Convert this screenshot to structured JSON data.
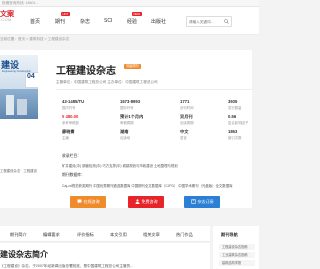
{
  "topbar": {
    "text": "投稿咨询热线: 18601..."
  },
  "logo": {
    "line1": "文案",
    "line2": ".COM"
  },
  "nav": [
    {
      "label": "首页"
    },
    {
      "label": "期刊",
      "badge": "HOT"
    },
    {
      "label": "杂志"
    },
    {
      "label": "SCI"
    },
    {
      "label": "经验",
      "badge": "NEW"
    },
    {
      "label": "出版社"
    }
  ],
  "search": {
    "placeholder": "请输入关键词..."
  },
  "breadcrumb": "当前位置：首页 > 建筑科技 > 工程建设杂志",
  "journal": {
    "cover": {
      "title": "建设",
      "subtitle": "Engineering Construction",
      "issue": "04"
    },
    "cover_caption": "工程建设杂志 · 工程建设",
    "title": "工程建设杂志",
    "tag": "省级期刊",
    "info": "主管单位：中国建筑工程总公司   主办单位：中国建筑工程总公司"
  },
  "fields": [
    {
      "value": "43-1485/TU",
      "label": "国内刊号"
    },
    {
      "value": "1673-8993",
      "label": "国际刊号"
    },
    {
      "value": "1771",
      "label": "创刊时间"
    },
    {
      "value": "3935",
      "label": "发行数量"
    },
    {
      "value": "¥ 480.00",
      "label": "参考审稿费"
    },
    {
      "value": "预计1个月内",
      "label": "审稿周期"
    },
    {
      "value": "双月刊",
      "label": "出版周期"
    },
    {
      "value": "0.56",
      "label": "复合影响因子"
    },
    {
      "value": "廖晓青",
      "label": "主编"
    },
    {
      "value": "湖南",
      "label": "出版地"
    },
    {
      "value": "中文",
      "label": "语言"
    },
    {
      "value": "1863",
      "label": "被引次数"
    }
  ],
  "columns_heading": "收录栏目：",
  "columns": "矿井建设(中)   钢管检测(中)   巧方支撑(中)   城镇规划与市政建设   土地整理与规划",
  "database_heading": "期刊数据库：",
  "databases": "Caj-cd规范获奖期刊   中国优秀期刊遴选数据库   中国期刊全文数据库（CJFD）   中国学术期刊（光盘版）全文数据库",
  "buttons": [
    {
      "label": "在线咨询",
      "color": "#f08b2c"
    },
    {
      "label": "免费咨询",
      "color": "#e8242b"
    },
    {
      "label": "杂志订阅",
      "color": "#2b7fd4"
    }
  ],
  "tabs": [
    "期刊简介",
    "编辑要求",
    "评价指标",
    "本文引用",
    "相关文章",
    "热门作品"
  ],
  "sidebar": {
    "title": "期刊导航",
    "items": [
      "工程建设杂志投稿",
      "工业建筑杂志投稿",
      "建筑结构学报"
    ]
  },
  "main": {
    "title": "建设杂志简介",
    "text": "《工程建设》杂志，于2007年经新闻出版总署批准，是中国建筑工程总公司主管的..."
  }
}
